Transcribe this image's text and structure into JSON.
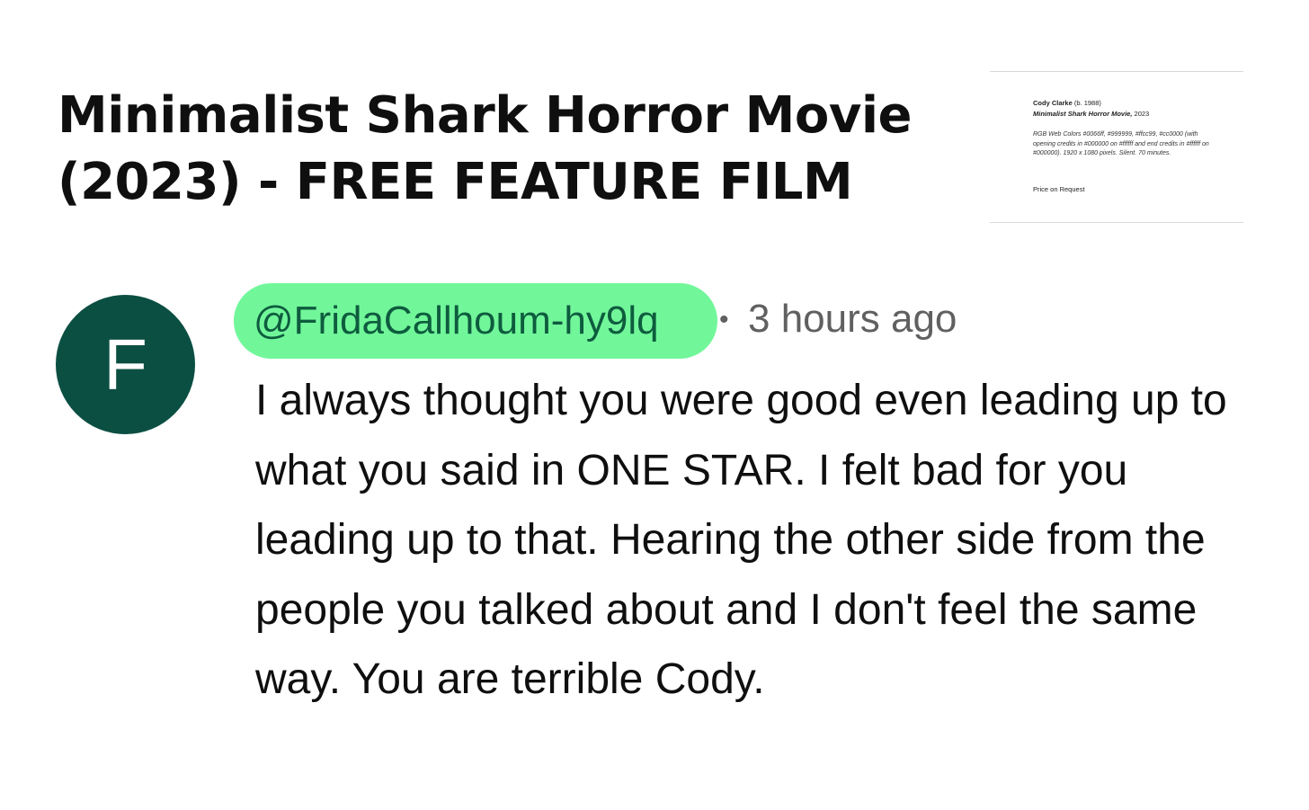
{
  "video": {
    "title": "Minimalist Shark Horror Movie (2023) - FREE FEATURE FILM",
    "thumbnail": {
      "artist": "Cody Clarke",
      "artist_born": "(b. 1988)",
      "work_title": "Minimalist Shark Horror Movie,",
      "work_year": "2023",
      "medium": "RGB Web Colors #0066ff, #999999, #ffcc99, #cc0000 (with opening credits in #000000 on #ffffff and end credits in #ffffff on #000000). 1920 x 1080 pixels. Silent. 70 minutes.",
      "price": "Price on Request"
    }
  },
  "comment": {
    "avatar_initial": "F",
    "avatar_color": "#0b4f42",
    "handle": "@FridaCallhoum-hy9lq",
    "handle_highlight_color": "#71f79a",
    "separator": "•",
    "timestamp": "3 hours ago",
    "text": "I always thought you were good even leading up to what you said in ONE STAR. I felt bad for you leading up to that. Hearing the other side from the people you talked about and I don't feel the same way. You are terrible Cody."
  }
}
